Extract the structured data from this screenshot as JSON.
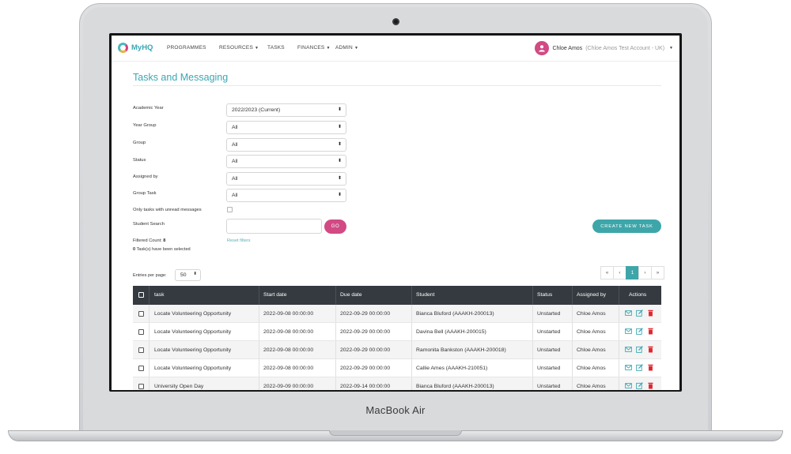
{
  "device": {
    "brand_label": "MacBook Air"
  },
  "navbar": {
    "logo_text": "MyHQ",
    "items": [
      {
        "label": "PROGRAMMES",
        "has_caret": false
      },
      {
        "label": "RESOURCES",
        "has_caret": true
      },
      {
        "label": "TASKS",
        "has_caret": false
      },
      {
        "label": "FINANCES",
        "has_caret": true
      },
      {
        "label": "ADMIN",
        "has_caret": true
      }
    ],
    "user_name": "Chloe Amos",
    "user_account": "(Chloe Amos Test Account - UK)"
  },
  "page": {
    "title": "Tasks and Messaging"
  },
  "filters": {
    "academic_year_label": "Academic Year",
    "academic_year_value": "2022/2023 (Current)",
    "year_group_label": "Year Group",
    "year_group_value": "All",
    "group_label": "Group",
    "group_value": "All",
    "status_label": "Status",
    "status_value": "All",
    "assigned_by_label": "Assigned by",
    "assigned_by_value": "All",
    "group_task_label": "Group Task",
    "group_task_value": "All",
    "unread_label": "Only tasks with unread messages",
    "student_search_label": "Student Search",
    "student_search_value": "",
    "go_label": "GO",
    "filtered_count_label": "Filtered Count:",
    "filtered_count_value": "8",
    "selected_count": "0",
    "selected_text": "Task(s) have been selected",
    "reset_label": "Reset filters",
    "create_label": "CREATE NEW TASK"
  },
  "pagination": {
    "entries_label": "Entries per page:",
    "entries_value": "50",
    "buttons": [
      "«",
      "‹",
      "1",
      "›",
      "»"
    ],
    "active_page": "1"
  },
  "table": {
    "headers": {
      "task": "task",
      "start": "Start date",
      "due": "Due date",
      "student": "Student",
      "status": "Status",
      "assigned": "Assigned by",
      "actions": "Actions"
    },
    "rows": [
      {
        "task": "Locate Volunteering Opportunity",
        "start": "2022-09-08 00:00:00",
        "due": "2022-09-29 00:00:00",
        "student": "Bianca Bluford (AAAKH-200013)",
        "status": "Unstarted",
        "assigned": "Chloe Amos"
      },
      {
        "task": "Locate Volunteering Opportunity",
        "start": "2022-09-08 00:00:00",
        "due": "2022-09-29 00:00:00",
        "student": "Davina Bell (AAAKH-200015)",
        "status": "Unstarted",
        "assigned": "Chloe Amos"
      },
      {
        "task": "Locate Volunteering Opportunity",
        "start": "2022-09-08 00:00:00",
        "due": "2022-09-29 00:00:00",
        "student": "Ramonita Bankston (AAAKH-200018)",
        "status": "Unstarted",
        "assigned": "Chloe Amos"
      },
      {
        "task": "Locate Volunteering Opportunity",
        "start": "2022-09-08 00:00:00",
        "due": "2022-09-29 00:00:00",
        "student": "Callie Ames (AAAKH-210051)",
        "status": "Unstarted",
        "assigned": "Chloe Amos"
      },
      {
        "task": "University Open Day",
        "start": "2022-09-09 00:00:00",
        "due": "2022-09-14 00:00:00",
        "student": "Bianca Bluford (AAAKH-200013)",
        "status": "Unstarted",
        "assigned": "Chloe Amos"
      }
    ]
  },
  "colors": {
    "brand_teal": "#3aa7b3",
    "brand_pink": "#d14a84",
    "header_dark": "#343a40"
  }
}
